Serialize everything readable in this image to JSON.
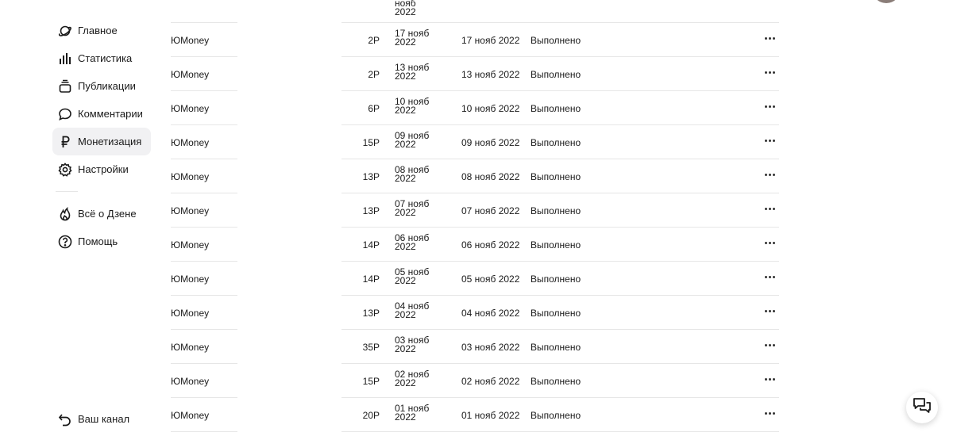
{
  "sidebar": {
    "items": [
      {
        "label": "Главное",
        "icon": "planet-icon"
      },
      {
        "label": "Статистика",
        "icon": "stats-icon"
      },
      {
        "label": "Публикации",
        "icon": "publications-icon"
      },
      {
        "label": "Комментарии",
        "icon": "comment-icon"
      },
      {
        "label": "Монетизация",
        "icon": "ruble-icon",
        "active": true
      },
      {
        "label": "Настройки",
        "icon": "gear-icon"
      }
    ],
    "secondary": [
      {
        "label": "Всё о Дзене",
        "icon": "flame-icon"
      },
      {
        "label": "Помощь",
        "icon": "help-icon"
      }
    ],
    "bottom": {
      "label": "Ваш канал",
      "icon": "back-arrow-icon"
    }
  },
  "table": {
    "partial_row": {
      "date_line1": "нояб",
      "date_line2": "2022"
    },
    "rows": [
      {
        "recipient": "ЮMoney",
        "amount": "2Р",
        "date_a_line1": "17 нояб",
        "date_a_line2": "2022",
        "date_b": "17 нояб 2022",
        "status": "Выполнено"
      },
      {
        "recipient": "ЮMoney",
        "amount": "2Р",
        "date_a_line1": "13 нояб",
        "date_a_line2": "2022",
        "date_b": "13 нояб 2022",
        "status": "Выполнено"
      },
      {
        "recipient": "ЮMoney",
        "amount": "6Р",
        "date_a_line1": "10 нояб",
        "date_a_line2": "2022",
        "date_b": "10 нояб 2022",
        "status": "Выполнено"
      },
      {
        "recipient": "ЮMoney",
        "amount": "15Р",
        "date_a_line1": "09 нояб",
        "date_a_line2": "2022",
        "date_b": "09 нояб 2022",
        "status": "Выполнено"
      },
      {
        "recipient": "ЮMoney",
        "amount": "13Р",
        "date_a_line1": "08 нояб",
        "date_a_line2": "2022",
        "date_b": "08 нояб 2022",
        "status": "Выполнено"
      },
      {
        "recipient": "ЮMoney",
        "amount": "13Р",
        "date_a_line1": "07 нояб",
        "date_a_line2": "2022",
        "date_b": "07 нояб 2022",
        "status": "Выполнено"
      },
      {
        "recipient": "ЮMoney",
        "amount": "14Р",
        "date_a_line1": "06 нояб",
        "date_a_line2": "2022",
        "date_b": "06 нояб 2022",
        "status": "Выполнено"
      },
      {
        "recipient": "ЮMoney",
        "amount": "14Р",
        "date_a_line1": "05 нояб",
        "date_a_line2": "2022",
        "date_b": "05 нояб 2022",
        "status": "Выполнено"
      },
      {
        "recipient": "ЮMoney",
        "amount": "13Р",
        "date_a_line1": "04 нояб",
        "date_a_line2": "2022",
        "date_b": "04 нояб 2022",
        "status": "Выполнено"
      },
      {
        "recipient": "ЮMoney",
        "amount": "35Р",
        "date_a_line1": "03 нояб",
        "date_a_line2": "2022",
        "date_b": "03 нояб 2022",
        "status": "Выполнено"
      },
      {
        "recipient": "ЮMoney",
        "amount": "15Р",
        "date_a_line1": "02 нояб",
        "date_a_line2": "2022",
        "date_b": "02 нояб 2022",
        "status": "Выполнено"
      },
      {
        "recipient": "ЮMoney",
        "amount": "20Р",
        "date_a_line1": "01 нояб",
        "date_a_line2": "2022",
        "date_b": "01 нояб 2022",
        "status": "Выполнено"
      }
    ]
  },
  "colors": {
    "active_bg": "#f1f1f3",
    "separator": "#e6e6e6",
    "text": "#1a1a1a"
  }
}
